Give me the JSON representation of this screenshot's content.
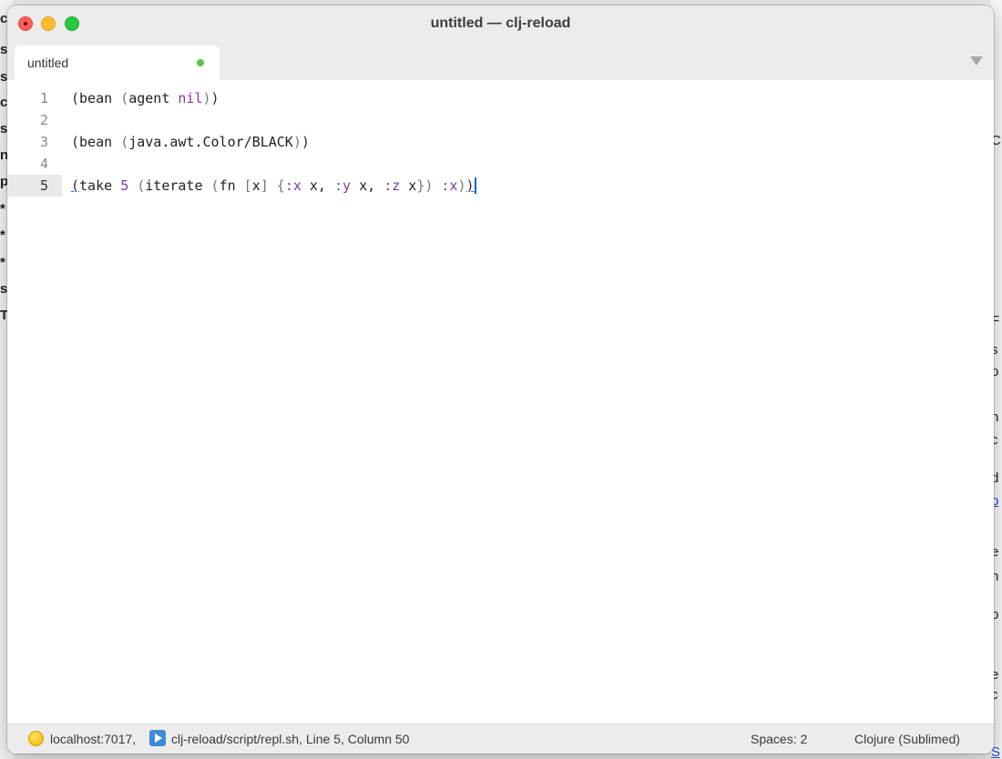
{
  "background": {
    "left_glyphs": [
      "c",
      "s",
      "s",
      "c",
      "s",
      "n",
      "p",
      "*",
      "*",
      "*",
      "s",
      "T"
    ],
    "right_glyphs": [
      "C",
      "F",
      "s",
      "o",
      "n",
      "c",
      "d",
      "b",
      "e",
      "n",
      "o",
      "e",
      "c",
      "S"
    ]
  },
  "window": {
    "title": "untitled — clj-reload"
  },
  "tabs": [
    {
      "label": "untitled",
      "dirty": true
    }
  ],
  "editor": {
    "line_numbers": [
      "1",
      "2",
      "3",
      "4",
      "5"
    ],
    "current_line": 5,
    "lines": [
      "(bean (agent nil))",
      "",
      "(bean (java.awt.Color/BLACK))",
      "",
      "(take 5 (iterate (fn [x] {:x x, :y x, :z x}) :x))"
    ],
    "tokens": {
      "l1": [
        "(",
        "bean ",
        "(",
        "agent ",
        "nil",
        ")",
        ")"
      ],
      "l3": [
        "(",
        "bean ",
        "(",
        "java.awt.Color/BLACK",
        ")",
        ")"
      ],
      "l5": [
        "(",
        "take ",
        "5",
        " ",
        "(",
        "iterate ",
        "(",
        "fn ",
        "[",
        "x",
        "]",
        " ",
        "{",
        ":x",
        " x, ",
        ":y",
        " x, ",
        ":z",
        " x",
        "}",
        ")",
        " ",
        ":x",
        ")",
        ")"
      ]
    }
  },
  "statusbar": {
    "host": "localhost:7017,",
    "script": "clj-reload/script/repl.sh, Line 5, Column 50",
    "spaces": "Spaces: 2",
    "syntax": "Clojure (Sublimed)"
  },
  "colors": {
    "keyword": "#7c3aa6",
    "dirty_dot": "#5ec04f",
    "cursor": "#1f5fd1",
    "close": "#fe5f57",
    "minimize": "#febc2e",
    "maximize": "#28c840"
  },
  "icons": [
    "close-icon",
    "minimize-icon",
    "maximize-icon",
    "dropdown-arrow-icon",
    "repl-status-icon",
    "play-icon"
  ]
}
